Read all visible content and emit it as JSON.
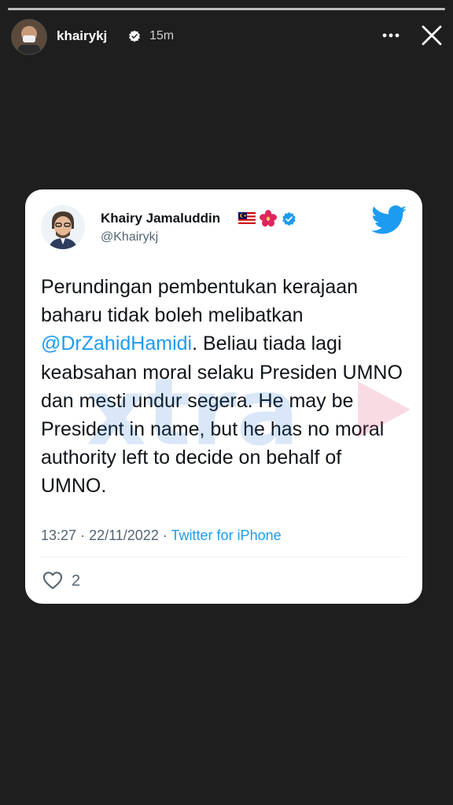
{
  "story": {
    "username": "khairykj",
    "time_ago": "15m",
    "progress": 1.0
  },
  "tweet": {
    "display_name": "Khairy Jamaluddin",
    "handle": "@Khairykj",
    "text_before_mention": "Perundingan pembentukan kerajaan baharu tidak boleh melibatkan ",
    "mention": "@DrZahidHamidi",
    "text_after_mention": ". Beliau tiada lagi keabsahan moral selaku Presiden UMNO dan mesti undur segera. He may be President in name, but he has no moral authority left to decide on behalf of UMNO.",
    "time": "13:27",
    "date": "22/11/2022",
    "separator": "·",
    "source": "Twitter for iPhone",
    "like_count": "2"
  },
  "watermark_text": "xtra",
  "colors": {
    "background": "#1e1e1e",
    "card": "#ffffff",
    "twitter_blue": "#1d9bf0",
    "secondary_text": "#536471"
  },
  "icons": {
    "more": "more-horizontal-icon",
    "close": "close-icon",
    "verified": "verified-badge-icon",
    "twitter": "twitter-bird-icon",
    "like": "heart-icon",
    "flag": "malaysia-flag-icon",
    "hibiscus": "hibiscus-icon"
  }
}
